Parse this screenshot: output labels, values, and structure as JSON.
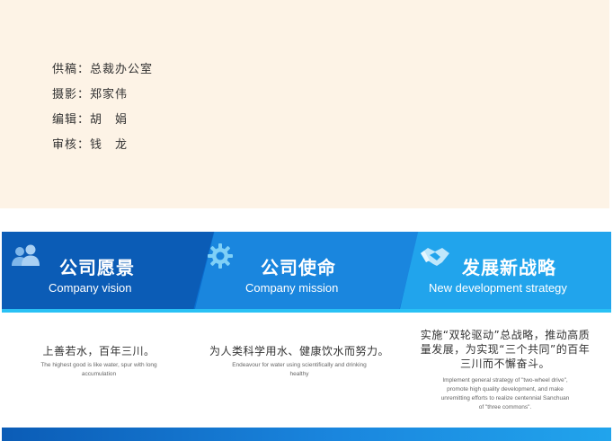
{
  "credits": [
    {
      "label": "供稿：",
      "value": "总裁办公室"
    },
    {
      "label": "摄影：",
      "value": "郑家伟"
    },
    {
      "label": "编辑：",
      "value": "胡　娟"
    },
    {
      "label": "审核：",
      "value": "钱　龙"
    }
  ],
  "panels": [
    {
      "icon": "people-icon",
      "title": "公司愿景",
      "subtitle": "Company vision",
      "cn": "上善若水，百年三川。",
      "en": "The highest good is like water, spur with long accumulation"
    },
    {
      "icon": "gear-icon",
      "title": "公司使命",
      "subtitle": "Company mission",
      "cn": "为人类科学用水、健康饮水而努力。",
      "en": "Endeavour for water using scientifically and drinking healthy"
    },
    {
      "icon": "handshake-icon",
      "title": "发展新战略",
      "subtitle": "New development strategy",
      "cn": "实施“双轮驱动”总战略，推动高质量发展，为实现“三个共同”的百年三川而不懈奋斗。",
      "en": "Implement general strategy of \"two-wheel drive\", promote high quality development, and make unremitting efforts to realize centennial Sanchuan of \"three commons\"."
    }
  ],
  "colors": {
    "credits_bg": "#fdf3e6",
    "banner_dark": "#0b5cb6",
    "banner_mid": "#1a86de",
    "banner_light": "#21a4ec",
    "accent": "#29c1f5"
  }
}
